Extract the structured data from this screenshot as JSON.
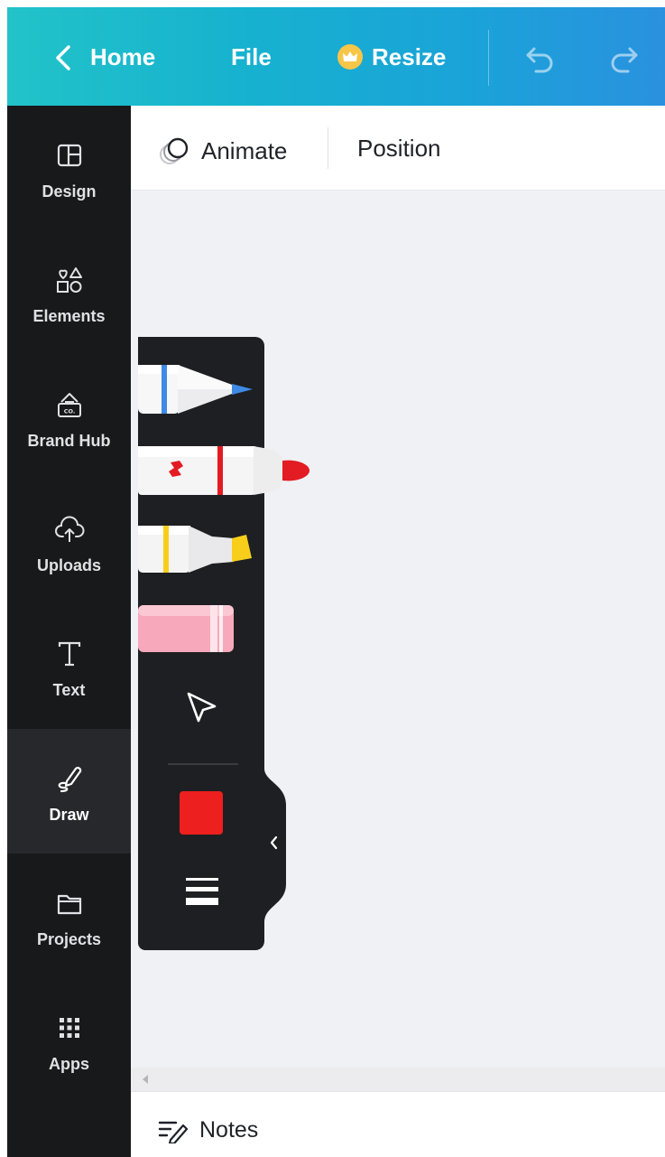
{
  "header": {
    "home_label": "Home",
    "file_label": "File",
    "resize_label": "Resize",
    "icons": {
      "back": "chevron-left-icon",
      "resize": "crown-icon",
      "undo": "undo-icon",
      "redo": "redo-icon"
    }
  },
  "sidebar": {
    "items": [
      {
        "label": "Design",
        "icon": "layout-icon",
        "active": false
      },
      {
        "label": "Elements",
        "icon": "shapes-icon",
        "active": false
      },
      {
        "label": "Brand Hub",
        "icon": "brand-hub-icon",
        "active": false
      },
      {
        "label": "Uploads",
        "icon": "cloud-upload-icon",
        "active": false
      },
      {
        "label": "Text",
        "icon": "text-icon",
        "active": false
      },
      {
        "label": "Draw",
        "icon": "draw-icon",
        "active": true
      },
      {
        "label": "Projects",
        "icon": "folder-icon",
        "active": false
      },
      {
        "label": "Apps",
        "icon": "apps-grid-icon",
        "active": false
      }
    ]
  },
  "toolbar": {
    "animate_label": "Animate",
    "position_label": "Position"
  },
  "draw_panel": {
    "tools": [
      "pen",
      "marker",
      "highlighter",
      "eraser"
    ],
    "selected_color": "#ee1f1f",
    "colors": {
      "pen": "#3e8ae5",
      "marker": "#e31b23",
      "highlighter": "#f7cf1a",
      "eraser": "#f7a9bb"
    }
  },
  "footer": {
    "notes_label": "Notes"
  },
  "colors": {
    "topbar_start": "#22c3c9",
    "topbar_end": "#2a91df",
    "sidebar_bg": "#18191b",
    "canvas_bg": "#f0f1f5",
    "panel_bg": "#1e1f22"
  }
}
